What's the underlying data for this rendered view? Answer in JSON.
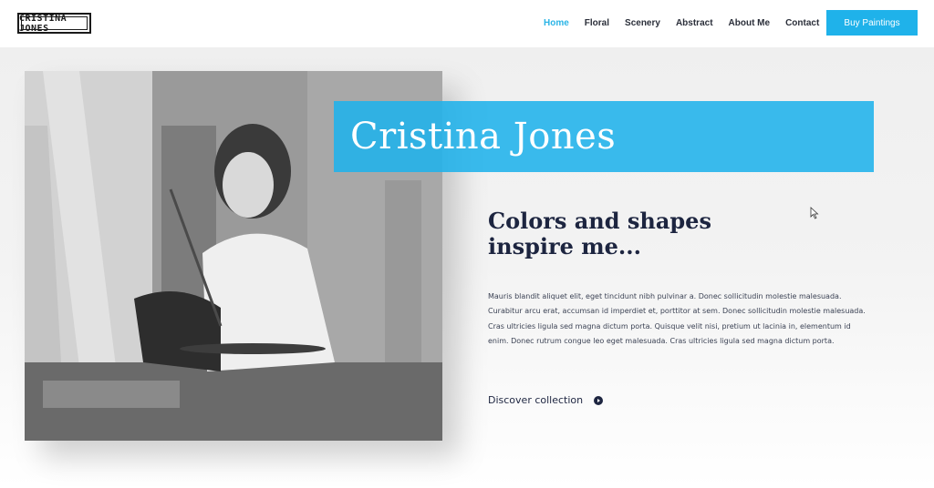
{
  "header": {
    "logo_text": "Cristina Jones",
    "nav": [
      {
        "label": "Home",
        "active": true
      },
      {
        "label": "Floral",
        "active": false
      },
      {
        "label": "Scenery",
        "active": false
      },
      {
        "label": "Abstract",
        "active": false
      },
      {
        "label": "About Me",
        "active": false
      },
      {
        "label": "Contact",
        "active": false
      }
    ],
    "cta_label": "Buy Paintings"
  },
  "hero": {
    "name": "Cristina Jones",
    "tagline_line1": "Colors and shapes",
    "tagline_line2": "inspire me...",
    "body": "Mauris blandit aliquet elit, eget tincidunt nibh pulvinar a. Donec sollicitudin molestie malesuada. Curabitur arcu erat, accumsan id imperdiet et, porttitor at sem. Donec sollicitudin molestie malesuada. Cras ultricies ligula sed magna dictum porta. Quisque velit nisi, pretium ut lacinia in, elementum id enim. Donec rutrum congue leo eget malesuada. Cras ultricies ligula sed magna dictum porta.",
    "discover_label": "Discover collection"
  },
  "colors": {
    "accent": "#1fb2ea",
    "active_nav": "#2ab4e6",
    "heading": "#1d2540"
  },
  "icons": {
    "discover": "play-circle-icon",
    "cursor": "mouse-cursor-icon"
  }
}
